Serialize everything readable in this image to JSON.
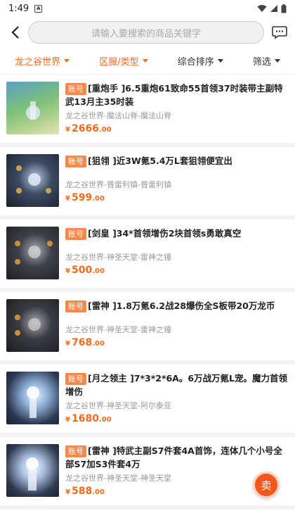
{
  "status": {
    "time": "1:49"
  },
  "search": {
    "placeholder": "请输入要搜索的商品关键字"
  },
  "filters": [
    {
      "label": "龙之谷世界"
    },
    {
      "label": "区服/类型"
    },
    {
      "label": "综合排序"
    },
    {
      "label": "筛选"
    }
  ],
  "items": [
    {
      "tag": "账号",
      "title": "[重炮手 ]6.5重炮61致命55首领37时装带主副特武13月主35时装",
      "server": "龙之谷世界-魔法山脊-魔法山脊",
      "price_int": "2666",
      "price_dec": ".00",
      "currency": "¥"
    },
    {
      "tag": "账号",
      "title": "[狙翎 ]近3W氪5.4万L套狙翎便宜出",
      "server": "龙之谷世界-普雷利镇-普雷利镇",
      "price_int": "599",
      "price_dec": ".00",
      "currency": "¥"
    },
    {
      "tag": "账号",
      "title": "[剑皇 ]34*首领增伤2块首领s勇敢真空",
      "server": "龙之谷世界-神圣天堂-雷神之锤",
      "price_int": "500",
      "price_dec": ".00",
      "currency": "¥"
    },
    {
      "tag": "账号",
      "title": "[雷神 ]1.8万氪6.2战28爆伤全S板带20万龙币",
      "server": "龙之谷世界-神圣天堂-雷神之锤",
      "price_int": "768",
      "price_dec": ".00",
      "currency": "¥"
    },
    {
      "tag": "账号",
      "title": "[月之领主 ]7*3*2*6A。6万战万氪L宠。魔力首领增伤",
      "server": "龙之谷世界-神圣天堂-阿尔泰亚",
      "price_int": "1680",
      "price_dec": ".00",
      "currency": "¥"
    },
    {
      "tag": "账号",
      "title": "[雷神 ]特武主副S7件套4A首饰，连体几个小号全部S7加S3件套4万",
      "server": "龙之谷世界-神圣天堂-神圣天堂",
      "price_int": "588",
      "price_dec": ".00",
      "currency": "¥"
    }
  ],
  "sell_button": {
    "label": "卖"
  },
  "colors": {
    "accent": "#f26b1d",
    "tag_bg": "#f7894a"
  }
}
